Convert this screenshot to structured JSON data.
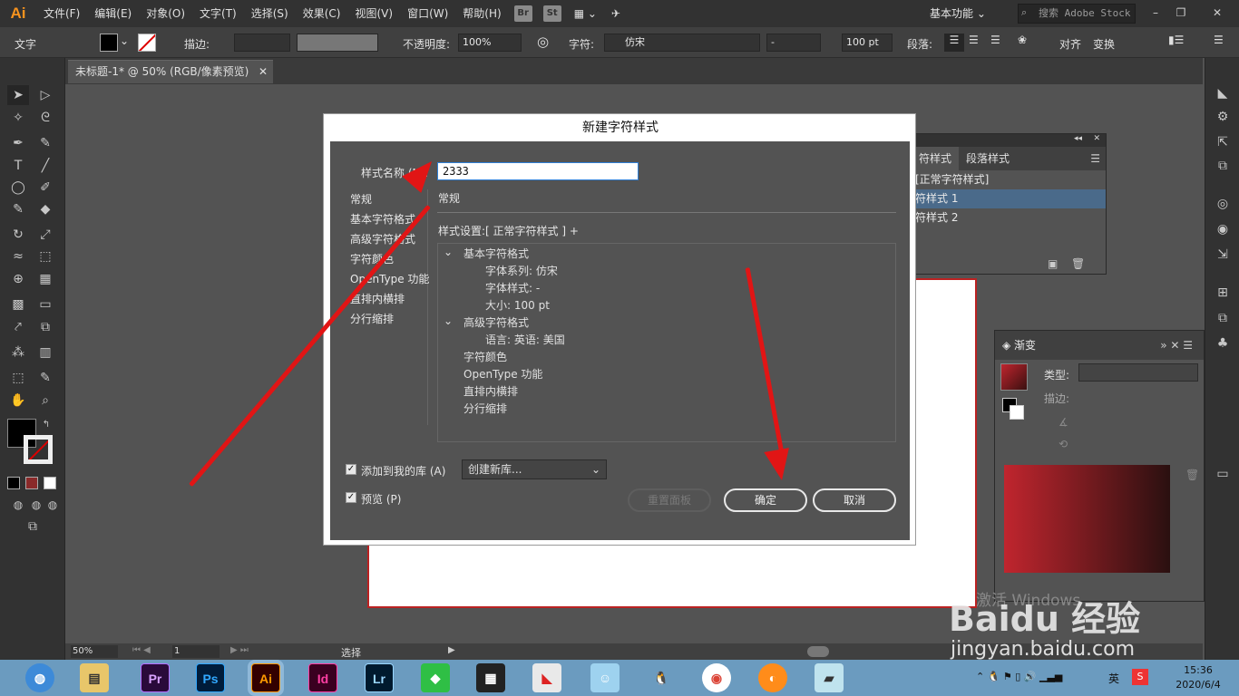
{
  "menu": {
    "logo": "Ai",
    "items": [
      "文件(F)",
      "编辑(E)",
      "对象(O)",
      "文字(T)",
      "选择(S)",
      "效果(C)",
      "视图(V)",
      "窗口(W)",
      "帮助(H)"
    ],
    "br": "Br",
    "st": "St",
    "workspace": "基本功能",
    "search_placeholder": "搜索 Adobe Stock"
  },
  "control_bar": {
    "type_label": "文字",
    "stroke_label": "描边:",
    "opacity_label": "不透明度:",
    "opacity_value": "100%",
    "char_label": "字符:",
    "font_value": "仿宋",
    "style_value": "-",
    "size_value": "100 pt",
    "para_label": "段落:",
    "align_label": "对齐",
    "transform_label": "变换"
  },
  "document": {
    "tab_title": "未标题-1* @ 50% (RGB/像素预览)",
    "zoom": "50%",
    "page": "1",
    "status_tool": "选择"
  },
  "dialog": {
    "title": "新建字符样式",
    "style_name_label": "样式名称 (N):",
    "style_name_value": "2333",
    "categories": [
      "常规",
      "基本字符格式",
      "高级字符格式",
      "字符颜色",
      "OpenType 功能",
      "直排内横排",
      "分行缩排"
    ],
    "section_title": "常规",
    "style_settings": "样式设置:[ 正常字符样式 ] +",
    "summary": {
      "basic_header": "基本字符格式",
      "font_family": "字体系列: 仿宋",
      "font_style": "字体样式: -",
      "size": "大小: 100 pt",
      "adv_header": "高级字符格式",
      "language": "语言: 英语: 美国",
      "char_color": "字符颜色",
      "opentype": "OpenType 功能",
      "tate": "直排内横排",
      "warichu": "分行缩排"
    },
    "add_to_library_label": "添加到我的库 (A)",
    "library_select": "创建新库...",
    "preview_label": "预览 (P)",
    "reset_label": "重置面板",
    "ok_label": "确定",
    "cancel_label": "取消"
  },
  "char_styles_panel": {
    "tab_char": "符样式",
    "tab_para": "段落样式",
    "rows": [
      "[正常字符样式]",
      "符样式 1",
      "符样式 2"
    ]
  },
  "gradient_panel": {
    "title": "渐变",
    "type_label": "类型:",
    "stroke_label": "描边:"
  },
  "taskbar": {
    "apps": [
      "Pr",
      "Ps",
      "Ai",
      "Id",
      "Lr"
    ],
    "time": "15:36",
    "date": "2020/6/4",
    "ime": "英"
  },
  "watermark": {
    "activate": "激活 Windows",
    "brand": "Baidu 经验",
    "url": "jingyan.baidu.com"
  },
  "colors": {
    "accent_red": "#e11515",
    "ai_orange": "#f7931e",
    "selection_blue": "#4a6a8a"
  }
}
